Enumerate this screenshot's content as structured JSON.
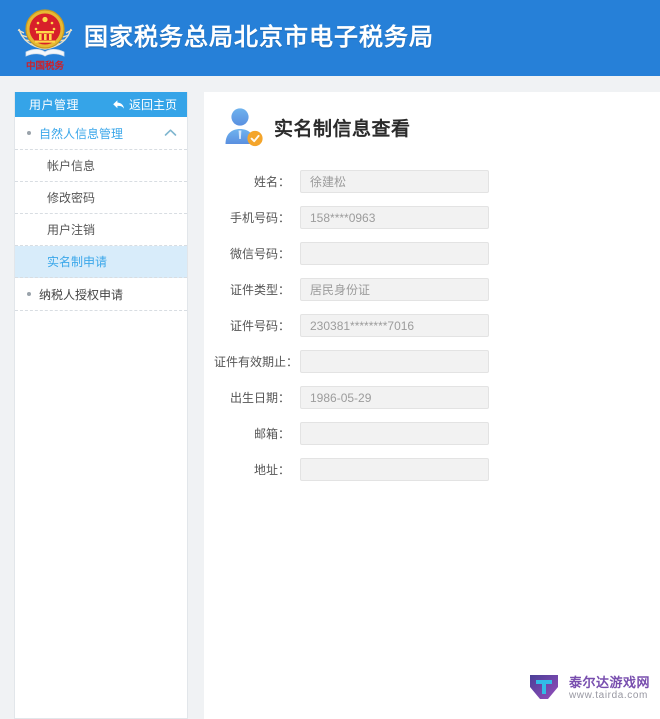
{
  "header": {
    "title": "国家税务总局北京市电子税务局",
    "emblem_icon": "china-tax-emblem-icon",
    "emblem_caption": "中国税务",
    "brand_color": "#2680d8"
  },
  "sidebar": {
    "head": {
      "title": "用户管理",
      "back_label": "返回主页",
      "back_icon": "back-arrow-icon",
      "background_color": "#35a4e8"
    },
    "groups": [
      {
        "label": "自然人信息管理",
        "expanded": true,
        "chevron_icon": "chevron-up-icon",
        "bullet_icon": "bullet-dot-icon",
        "items": [
          {
            "label": "帐户信息",
            "active": false
          },
          {
            "label": "修改密码",
            "active": false
          },
          {
            "label": "用户注销",
            "active": false
          },
          {
            "label": "实名制申请",
            "active": true
          }
        ]
      },
      {
        "label": "纳税人授权申请",
        "expanded": false,
        "chevron_icon": "",
        "bullet_icon": "bullet-dot-icon",
        "items": []
      }
    ],
    "active_item_color": "#d8ecfa",
    "active_text_color": "#3ba7ea"
  },
  "main": {
    "panel_icon": "verified-user-icon",
    "panel_title": "实名制信息查看",
    "fields": [
      {
        "label": "姓名：",
        "value": "徐建松"
      },
      {
        "label": "手机号码：",
        "value": "158****0963"
      },
      {
        "label": "微信号码：",
        "value": ""
      },
      {
        "label": "证件类型：",
        "value": "居民身份证"
      },
      {
        "label": "证件号码：",
        "value": "230381********7016"
      },
      {
        "label": "证件有效期止：",
        "value": ""
      },
      {
        "label": "出生日期：",
        "value": "1986-05-29"
      },
      {
        "label": "邮箱：",
        "value": ""
      },
      {
        "label": "地址：",
        "value": ""
      }
    ]
  },
  "watermark": {
    "logo_icon": "tairda-logo-icon",
    "name": "泰尔达游戏网",
    "url": "www.tairda.com"
  }
}
